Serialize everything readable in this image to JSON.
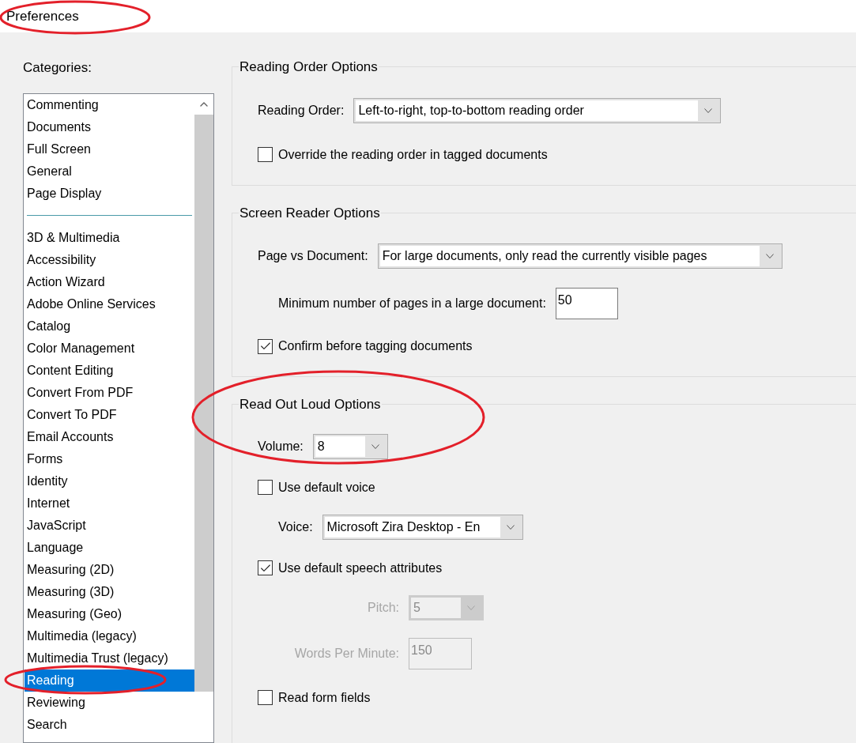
{
  "window": {
    "title": "Preferences"
  },
  "categories": {
    "label": "Categories:",
    "groups": [
      {
        "items": [
          {
            "label": "Commenting",
            "selected": false
          },
          {
            "label": "Documents",
            "selected": false
          },
          {
            "label": "Full Screen",
            "selected": false
          },
          {
            "label": "General",
            "selected": false
          },
          {
            "label": "Page Display",
            "selected": false
          }
        ]
      },
      {
        "items": [
          {
            "label": "3D & Multimedia",
            "selected": false
          },
          {
            "label": "Accessibility",
            "selected": false
          },
          {
            "label": "Action Wizard",
            "selected": false
          },
          {
            "label": "Adobe Online Services",
            "selected": false
          },
          {
            "label": "Catalog",
            "selected": false
          },
          {
            "label": "Color Management",
            "selected": false
          },
          {
            "label": "Content Editing",
            "selected": false
          },
          {
            "label": "Convert From PDF",
            "selected": false
          },
          {
            "label": "Convert To PDF",
            "selected": false
          },
          {
            "label": "Email Accounts",
            "selected": false
          },
          {
            "label": "Forms",
            "selected": false
          },
          {
            "label": "Identity",
            "selected": false
          },
          {
            "label": "Internet",
            "selected": false
          },
          {
            "label": "JavaScript",
            "selected": false
          },
          {
            "label": "Language",
            "selected": false
          },
          {
            "label": "Measuring (2D)",
            "selected": false
          },
          {
            "label": "Measuring (3D)",
            "selected": false
          },
          {
            "label": "Measuring (Geo)",
            "selected": false
          },
          {
            "label": "Multimedia (legacy)",
            "selected": false
          },
          {
            "label": "Multimedia Trust (legacy)",
            "selected": false
          },
          {
            "label": "Reading",
            "selected": true
          },
          {
            "label": "Reviewing",
            "selected": false
          },
          {
            "label": "Search",
            "selected": false
          }
        ]
      }
    ]
  },
  "sections": [
    {
      "title": "Reading Order Options",
      "rows": [
        {
          "kind": "dropdown",
          "label": "Reading Order:",
          "value": "Left-to-right, top-to-bottom reading order",
          "disabled": false
        },
        {
          "kind": "checkbox",
          "label": "Override the reading order in tagged documents",
          "checked": false
        }
      ]
    },
    {
      "title": "Screen Reader Options",
      "rows": [
        {
          "kind": "dropdown",
          "label": "Page vs Document:",
          "value": "For large documents, only read the currently visible pages",
          "disabled": false,
          "children": [
            {
              "kind": "field",
              "label": "Minimum number of pages in a large document:",
              "value": "50",
              "disabled": false
            }
          ]
        },
        {
          "kind": "checkbox",
          "label": "Confirm before tagging documents",
          "checked": true
        }
      ]
    },
    {
      "title": "Read Out Loud Options",
      "rows": [
        {
          "kind": "dropdown",
          "label": "Volume:",
          "value": "8",
          "disabled": false
        },
        {
          "kind": "checkbox",
          "label": "Use default voice",
          "checked": false,
          "children": [
            {
              "kind": "dropdown",
              "label": "Voice:",
              "value": "Microsoft Zira Desktop - En",
              "disabled": false
            }
          ]
        },
        {
          "kind": "checkbox",
          "label": "Use default speech attributes",
          "checked": true,
          "children": [
            {
              "kind": "dropdown",
              "label": "Pitch:",
              "value": "5",
              "disabled": true
            },
            {
              "kind": "field",
              "label": "Words Per Minute:",
              "value": "150",
              "disabled": true
            }
          ]
        },
        {
          "kind": "checkbox",
          "label": "Read form fields",
          "checked": false
        }
      ]
    }
  ]
}
